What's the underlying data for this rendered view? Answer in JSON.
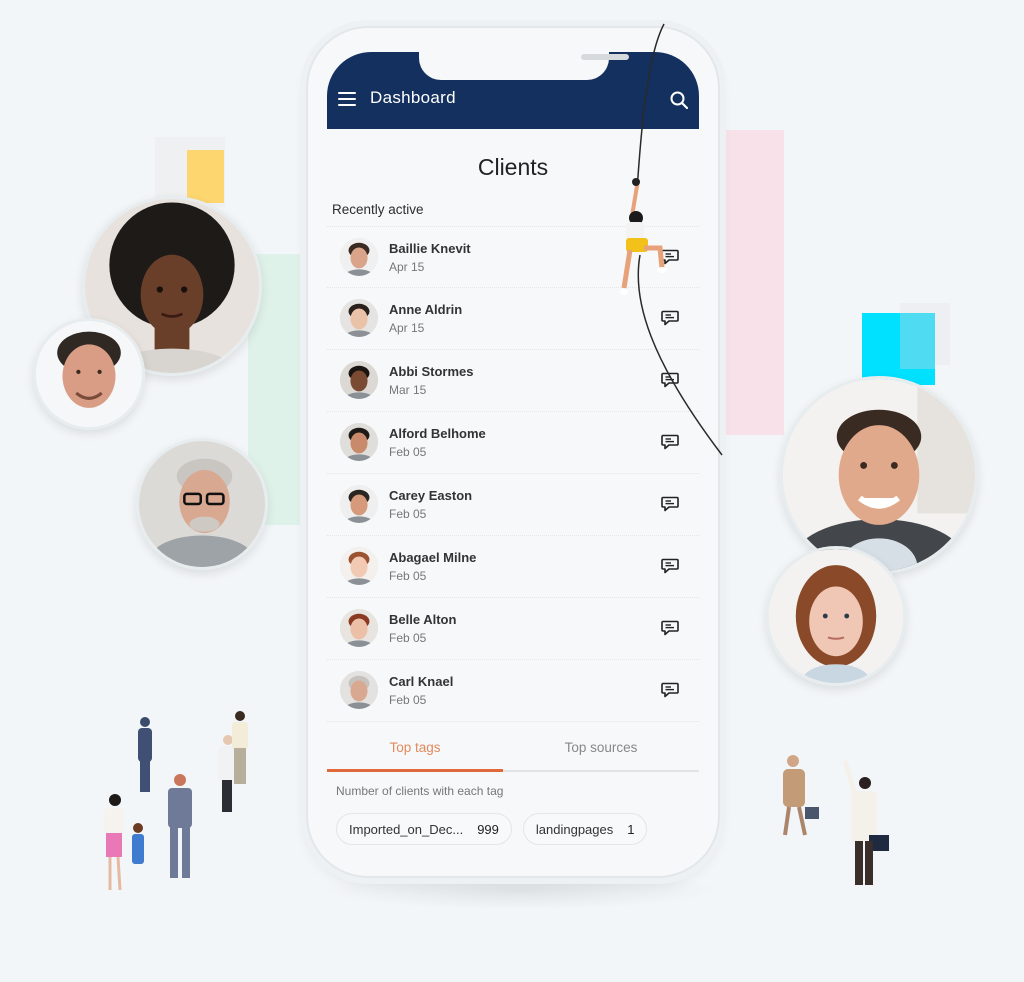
{
  "app": {
    "title": "Dashboard",
    "menu_icon": "hamburger-menu-icon",
    "search_icon": "search-icon"
  },
  "page": {
    "title": "Clients",
    "section_label": "Recently active"
  },
  "clients": [
    {
      "name": "Baillie Knevit",
      "date": "Apr 15"
    },
    {
      "name": "Anne Aldrin",
      "date": "Apr 15"
    },
    {
      "name": "Abbi Stormes",
      "date": "Mar 15"
    },
    {
      "name": "Alford Belhome",
      "date": "Feb 05"
    },
    {
      "name": "Carey Easton",
      "date": "Feb 05"
    },
    {
      "name": "Abagael Milne",
      "date": "Feb 05"
    },
    {
      "name": "Belle Alton",
      "date": "Feb 05"
    },
    {
      "name": "Carl Knael",
      "date": "Feb 05"
    }
  ],
  "tabs": [
    {
      "label": "Top tags",
      "active": true
    },
    {
      "label": "Top sources",
      "active": false
    }
  ],
  "tags": {
    "caption": "Number of clients with each tag",
    "items": [
      {
        "label": "Imported_on_Dec...",
        "count": "999"
      },
      {
        "label": "landingpages",
        "count": "1"
      }
    ]
  },
  "colors": {
    "appbar": "#13305e",
    "accent": "#e0683b",
    "background": "#f3f6f8"
  }
}
